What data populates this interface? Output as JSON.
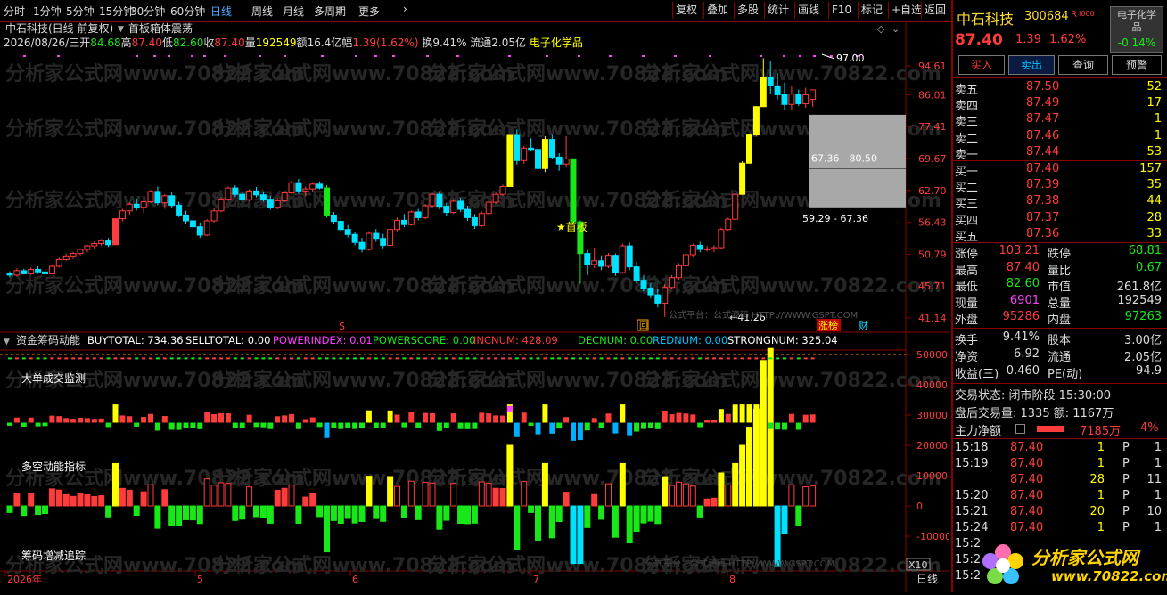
{
  "toolbar": {
    "periods": [
      "分时",
      "1分钟",
      "5分钟",
      "15分钟",
      "30分钟",
      "60分钟",
      "日线",
      "周线",
      "月线",
      "多周期",
      "更多"
    ],
    "active_period": "日线",
    "right_tools": [
      "复权",
      "叠加",
      "多股",
      "统计",
      "画线",
      "F10",
      "标记",
      "+自选",
      "返回"
    ]
  },
  "header": {
    "title": "中石科技(日线 前复权)",
    "indicator": "首板箱体震荡",
    "date": "2026/08/26/三",
    "open_label": "开",
    "open": "84.68",
    "high_label": "高",
    "high": "87.40",
    "low_label": "低",
    "low": "82.60",
    "close_label": "收",
    "close": "87.40",
    "volume_label": "量",
    "volume": "192549",
    "amount_label": "额",
    "amount": "16.4亿",
    "range_label": "幅",
    "range": "1.39(1.62%)",
    "turnover_label": "换",
    "turnover": "9.41%",
    "float_label": "流通",
    "float": "2.05亿",
    "sector": "电子化学品"
  },
  "main_chart": {
    "price_axis": [
      "94.61",
      "86.01",
      "77.41",
      "69.67",
      "62.70",
      "56.43",
      "50.79",
      "45.71",
      "41.14"
    ],
    "annotations": {
      "peak": "97.00",
      "low": "41.26",
      "first_board": "★首板",
      "box_upper": "67.36 - 80.50",
      "box_lower": "59.29 - 67.36",
      "watermark_platform": "公式平台：公式源码 HTTP://WWW.GSPT.COM",
      "limit_tag": "涨榜",
      "fin_tag": "财",
      "s_tag": "S",
      "hui_tag": "回"
    },
    "watermark": "分析家公式网www.70822.com"
  },
  "sub_chart": {
    "name": "资金筹码动能",
    "metrics": [
      {
        "label": "BUYTOTAL: 734.36",
        "color": "#ffffff"
      },
      {
        "label": "SELLTOTAL: 0.00",
        "color": "#ffffff"
      },
      {
        "label": "POWERINDEX: 0.01",
        "color": "#ff40ff"
      },
      {
        "label": "POWERSCORE: 0.00",
        "color": "#18e818"
      },
      {
        "label": "INCNUM: 428.09",
        "color": "#ff3c3c"
      },
      {
        "label": "DECNUM: 0.00",
        "color": "#18e818"
      },
      {
        "label": "REDNUM: 0.00",
        "color": "#00c0ff"
      },
      {
        "label": "STRONGNUM: 325.04",
        "color": "#ffffff"
      }
    ],
    "labels": {
      "big_order": "大单成交监测",
      "power": "多空动能指标",
      "chip": "筹码增减追踪"
    },
    "axis": [
      "50000",
      "40000",
      "30000",
      "20000",
      "10000",
      "0",
      "-10000"
    ],
    "zoom": "X10"
  },
  "time_axis": {
    "labels": [
      "2026年",
      "5",
      "6",
      "7",
      "8"
    ],
    "period": "日线"
  },
  "stock": {
    "name": "中石科技",
    "code": "300684",
    "flag": "R",
    "price": "87.40",
    "change": "1.39",
    "change_pct": "1.62%",
    "sector": "电子化学品",
    "sector_pct": "-0.14%"
  },
  "trade_buttons": [
    "买入",
    "卖出",
    "查询",
    "预警"
  ],
  "order_book": {
    "asks": [
      {
        "label": "卖五",
        "price": "87.50",
        "vol": "52"
      },
      {
        "label": "卖四",
        "price": "87.49",
        "vol": "17"
      },
      {
        "label": "卖三",
        "price": "87.47",
        "vol": "1"
      },
      {
        "label": "卖二",
        "price": "87.46",
        "vol": "1"
      },
      {
        "label": "卖一",
        "price": "87.44",
        "vol": "53"
      }
    ],
    "bids": [
      {
        "label": "买一",
        "price": "87.40",
        "vol": "157"
      },
      {
        "label": "买二",
        "price": "87.39",
        "vol": "35"
      },
      {
        "label": "买三",
        "price": "87.38",
        "vol": "44"
      },
      {
        "label": "买四",
        "price": "87.37",
        "vol": "28"
      },
      {
        "label": "买五",
        "price": "87.36",
        "vol": "33"
      }
    ]
  },
  "quote": [
    {
      "l1": "涨停",
      "v1": "103.21",
      "c1": "#ff3c3c",
      "l2": "跌停",
      "v2": "68.81",
      "c2": "#18e818"
    },
    {
      "l1": "最高",
      "v1": "87.40",
      "c1": "#ff3c3c",
      "l2": "量比",
      "v2": "0.67",
      "c2": "#18e818"
    },
    {
      "l1": "最低",
      "v1": "82.60",
      "c1": "#18e818",
      "l2": "市值",
      "v2": "261.8亿",
      "c2": "#dddddd"
    },
    {
      "l1": "现量",
      "v1": "6901",
      "c1": "#ff40ff",
      "l2": "总量",
      "v2": "192549",
      "c2": "#dddddd"
    },
    {
      "l1": "外盘",
      "v1": "95286",
      "c1": "#ff3c3c",
      "l2": "内盘",
      "v2": "97263",
      "c2": "#18e818"
    }
  ],
  "fundamentals": [
    {
      "l1": "换手",
      "v1": "9.41%",
      "l2": "股本",
      "v2": "3.00亿"
    },
    {
      "l1": "净资",
      "v1": "6.92",
      "l2": "流通",
      "v2": "2.05亿"
    },
    {
      "l1": "收益(三)",
      "v1": "0.460",
      "l2": "PE(动)",
      "v2": "94.9"
    }
  ],
  "status": {
    "trade_state": "交易状态: 闭市阶段 15:30:00",
    "after_hours": "盘后交易量: 1335  额: 1167万",
    "main_net_label": "主力净额",
    "main_net_value": "7185万",
    "main_net_pct": "4%"
  },
  "ticks": [
    {
      "time": "15:18",
      "price": "87.40",
      "vol": "1",
      "side": "P",
      "num": "1"
    },
    {
      "time": "15:19",
      "price": "87.40",
      "vol": "1",
      "side": "P",
      "num": "1"
    },
    {
      "time": "",
      "price": "87.40",
      "vol": "28",
      "side": "P",
      "num": "11"
    },
    {
      "time": "15:20",
      "price": "87.40",
      "vol": "1",
      "side": "P",
      "num": "1"
    },
    {
      "time": "15:21",
      "price": "87.40",
      "vol": "20",
      "side": "P",
      "num": "10"
    },
    {
      "time": "15:24",
      "price": "87.40",
      "vol": "1",
      "side": "P",
      "num": "1"
    },
    {
      "time": "15:2",
      "price": "",
      "vol": "",
      "side": "",
      "num": ""
    },
    {
      "time": "15:2",
      "price": "",
      "vol": "",
      "side": "",
      "num": ""
    },
    {
      "time": "15:2",
      "price": "",
      "vol": "",
      "side": "",
      "num": ""
    }
  ],
  "logo": {
    "text": "分析家公式网",
    "url": "www.70822.com"
  },
  "colors": {
    "up": "#ff3c3c",
    "down": "#00e0ff",
    "flat": "#18e818",
    "limit_up": "#ffff00",
    "box": "#a8a8a8",
    "grid": "#8a0000"
  },
  "candles": [
    [
      47.6,
      48.0,
      47.0,
      47.4
    ],
    [
      47.4,
      48.5,
      47.2,
      48.1
    ],
    [
      48.1,
      48.4,
      47.5,
      47.6
    ],
    [
      47.6,
      48.6,
      47.4,
      48.3
    ],
    [
      48.3,
      48.8,
      47.6,
      47.9
    ],
    [
      47.9,
      48.4,
      47.3,
      47.6
    ],
    [
      47.6,
      49.0,
      47.5,
      48.8
    ],
    [
      48.8,
      50.2,
      48.6,
      49.9
    ],
    [
      49.9,
      50.9,
      49.7,
      50.5
    ],
    [
      50.5,
      51.2,
      50.0,
      50.9
    ],
    [
      50.9,
      51.8,
      50.6,
      51.6
    ],
    [
      51.6,
      52.4,
      51.1,
      52.2
    ],
    [
      52.2,
      53.0,
      51.8,
      52.6
    ],
    [
      52.6,
      53.4,
      52.2,
      53.1
    ],
    [
      53.1,
      53.6,
      52.0,
      52.4
    ],
    [
      52.4,
      57.1,
      52.4,
      57.1
    ],
    [
      57.1,
      59.0,
      56.6,
      58.6
    ],
    [
      58.6,
      60.3,
      57.9,
      59.9
    ],
    [
      59.9,
      61.0,
      58.7,
      59.3
    ],
    [
      59.3,
      60.8,
      58.2,
      60.4
    ],
    [
      60.4,
      62.8,
      60.1,
      62.5
    ],
    [
      62.5,
      63.5,
      59.7,
      60.2
    ],
    [
      60.2,
      61.9,
      59.0,
      61.6
    ],
    [
      61.6,
      62.4,
      59.2,
      59.7
    ],
    [
      59.7,
      60.4,
      57.4,
      57.8
    ],
    [
      57.8,
      58.6,
      56.1,
      56.7
    ],
    [
      56.7,
      57.4,
      55.1,
      55.6
    ],
    [
      55.6,
      56.4,
      53.6,
      54.1
    ],
    [
      54.1,
      57.0,
      53.9,
      56.7
    ],
    [
      56.7,
      59.1,
      56.4,
      58.6
    ],
    [
      58.6,
      61.3,
      58.3,
      60.9
    ],
    [
      60.9,
      63.5,
      60.6,
      63.2
    ],
    [
      63.2,
      63.8,
      61.4,
      61.9
    ],
    [
      61.9,
      62.6,
      60.3,
      60.8
    ],
    [
      60.8,
      62.9,
      60.5,
      62.6
    ],
    [
      62.6,
      63.4,
      61.3,
      61.8
    ],
    [
      61.8,
      62.4,
      60.4,
      60.9
    ],
    [
      60.9,
      61.6,
      58.8,
      59.3
    ],
    [
      59.3,
      61.1,
      58.9,
      60.6
    ],
    [
      60.6,
      62.6,
      60.3,
      62.2
    ],
    [
      62.2,
      64.7,
      61.9,
      64.3
    ],
    [
      64.3,
      65.1,
      62.0,
      62.6
    ],
    [
      62.6,
      63.5,
      61.5,
      63.0
    ],
    [
      63.0,
      64.4,
      62.4,
      64.0
    ],
    [
      64.0,
      64.6,
      62.9,
      63.2
    ],
    [
      63.2,
      63.8,
      57.3,
      57.8
    ],
    [
      57.8,
      58.4,
      56.2,
      56.6
    ],
    [
      56.6,
      57.3,
      54.6,
      55.1
    ],
    [
      55.1,
      55.9,
      53.7,
      54.2
    ],
    [
      54.2,
      54.7,
      52.3,
      52.8
    ],
    [
      52.8,
      53.6,
      51.1,
      51.6
    ],
    [
      51.6,
      54.8,
      51.4,
      54.4
    ],
    [
      54.4,
      55.2,
      52.9,
      53.5
    ],
    [
      53.5,
      54.3,
      51.8,
      52.3
    ],
    [
      52.3,
      55.5,
      52.0,
      55.1
    ],
    [
      55.1,
      57.3,
      54.8,
      56.8
    ],
    [
      56.8,
      58.0,
      55.5,
      56.0
    ],
    [
      56.0,
      58.7,
      55.8,
      58.4
    ],
    [
      58.4,
      59.0,
      56.8,
      57.3
    ],
    [
      57.3,
      59.9,
      57.0,
      59.6
    ],
    [
      59.6,
      62.2,
      59.3,
      61.9
    ],
    [
      61.9,
      62.6,
      58.9,
      59.5
    ],
    [
      59.5,
      60.2,
      57.7,
      58.3
    ],
    [
      58.3,
      60.9,
      58.0,
      60.5
    ],
    [
      60.5,
      61.2,
      58.4,
      58.9
    ],
    [
      58.9,
      59.6,
      56.7,
      57.3
    ],
    [
      57.3,
      58.0,
      55.2,
      55.8
    ],
    [
      55.8,
      58.5,
      55.6,
      58.1
    ],
    [
      58.1,
      60.6,
      57.8,
      60.3
    ],
    [
      60.3,
      62.3,
      60.0,
      61.9
    ],
    [
      61.9,
      63.9,
      61.6,
      63.5
    ],
    [
      63.5,
      75.2,
      63.5,
      75.2
    ],
    [
      75.2,
      76.7,
      68.3,
      69.2
    ],
    [
      69.2,
      72.6,
      68.5,
      72.1
    ],
    [
      72.1,
      74.5,
      71.3,
      71.8
    ],
    [
      71.8,
      72.7,
      66.7,
      67.4
    ],
    [
      67.4,
      75.0,
      66.6,
      74.2
    ],
    [
      74.2,
      75.3,
      69.5,
      70.0
    ],
    [
      70.0,
      70.9,
      66.9,
      68.4
    ],
    [
      68.4,
      75.0,
      67.6,
      69.6
    ],
    [
      69.6,
      69.6,
      56.4,
      56.5
    ],
    [
      56.5,
      56.8,
      46.1,
      50.9
    ],
    [
      50.9,
      51.5,
      47.4,
      49.1
    ],
    [
      49.1,
      51.9,
      48.5,
      49.7
    ],
    [
      49.7,
      50.6,
      48.2,
      48.8
    ],
    [
      48.8,
      51.0,
      48.5,
      50.6
    ],
    [
      50.6,
      50.9,
      47.3,
      47.8
    ],
    [
      47.8,
      52.6,
      47.6,
      52.2
    ],
    [
      52.2,
      52.8,
      48.2,
      48.7
    ],
    [
      48.7,
      49.5,
      46.1,
      46.6
    ],
    [
      46.6,
      47.4,
      44.9,
      45.4
    ],
    [
      45.4,
      46.1,
      43.9,
      44.4
    ],
    [
      44.4,
      45.3,
      42.6,
      43.2
    ],
    [
      43.2,
      46.0,
      41.3,
      45.5
    ],
    [
      45.5,
      47.4,
      45.2,
      47.0
    ],
    [
      47.0,
      49.3,
      46.7,
      48.9
    ],
    [
      48.9,
      51.1,
      48.6,
      50.7
    ],
    [
      50.7,
      52.6,
      50.4,
      52.3
    ],
    [
      52.3,
      52.9,
      51.1,
      51.6
    ],
    [
      51.6,
      52.2,
      51.2,
      51.7
    ],
    [
      51.7,
      52.3,
      51.1,
      51.9
    ],
    [
      51.9,
      55.4,
      51.7,
      55.1
    ],
    [
      55.1,
      57.3,
      54.9,
      57.0
    ],
    [
      57.0,
      62.0,
      56.9,
      61.9
    ],
    [
      61.9,
      69.0,
      61.8,
      68.6
    ],
    [
      68.6,
      75.6,
      68.5,
      75.3
    ],
    [
      75.3,
      82.8,
      75.1,
      82.7
    ],
    [
      82.7,
      97.0,
      82.6,
      91.0
    ],
    [
      91.0,
      96.2,
      86.2,
      88.6
    ],
    [
      88.6,
      92.4,
      84.7,
      86.0
    ],
    [
      86.0,
      89.6,
      81.9,
      83.3
    ],
    [
      83.3,
      88.4,
      81.7,
      86.2
    ],
    [
      86.2,
      87.5,
      82.9,
      83.5
    ],
    [
      83.5,
      88.0,
      82.4,
      86.0
    ],
    [
      84.7,
      87.4,
      82.6,
      87.4
    ]
  ]
}
